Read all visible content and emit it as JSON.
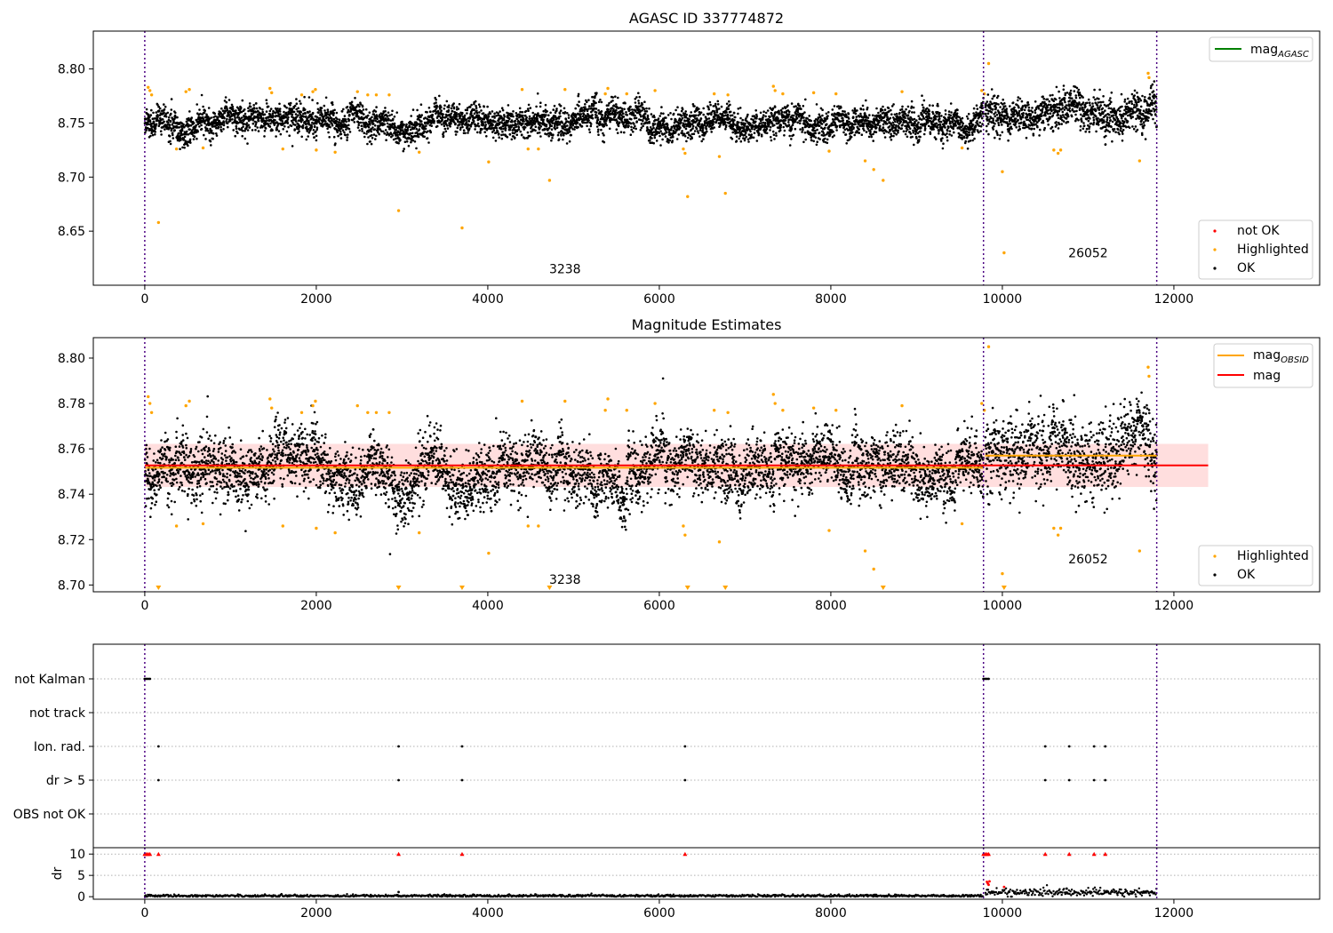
{
  "chart_data": [
    {
      "id": "agasc",
      "type": "scatter",
      "title": "AGASC ID 337774872",
      "xlim": [
        -600,
        13700
      ],
      "ylim": [
        8.6,
        8.835
      ],
      "xticks": [
        0,
        2000,
        4000,
        6000,
        8000,
        10000,
        12000
      ],
      "yticks": [
        8.65,
        8.7,
        8.75,
        8.8
      ],
      "obs_boundaries": [
        0,
        9780,
        11800
      ],
      "obs_labels": [
        {
          "text": "3238",
          "x": 4900,
          "y": 8.611
        },
        {
          "text": "26052",
          "x": 11000,
          "y": 8.626
        }
      ],
      "ok_bands": [
        {
          "x0": 0,
          "x1": 9780,
          "center": 8.751,
          "spread": 0.012
        },
        {
          "x0": 9800,
          "x1": 11800,
          "center": 8.757,
          "spread": 0.015
        }
      ],
      "highlighted": [
        [
          40,
          8.783
        ],
        [
          60,
          8.78
        ],
        [
          80,
          8.776
        ],
        [
          160,
          8.658
        ],
        [
          370,
          8.726
        ],
        [
          480,
          8.779
        ],
        [
          520,
          8.781
        ],
        [
          680,
          8.727
        ],
        [
          1460,
          8.782
        ],
        [
          1480,
          8.778
        ],
        [
          1610,
          8.726
        ],
        [
          1830,
          8.776
        ],
        [
          1960,
          8.779
        ],
        [
          1990,
          8.781
        ],
        [
          2000,
          8.725
        ],
        [
          2220,
          8.723
        ],
        [
          2480,
          8.779
        ],
        [
          2600,
          8.776
        ],
        [
          2700,
          8.776
        ],
        [
          2850,
          8.776
        ],
        [
          2960,
          8.669
        ],
        [
          3200,
          8.723
        ],
        [
          3700,
          8.653
        ],
        [
          4010,
          8.714
        ],
        [
          4400,
          8.781
        ],
        [
          4470,
          8.726
        ],
        [
          4590,
          8.726
        ],
        [
          4720,
          8.697
        ],
        [
          4900,
          8.781
        ],
        [
          5370,
          8.777
        ],
        [
          5400,
          8.782
        ],
        [
          5620,
          8.777
        ],
        [
          5950,
          8.78
        ],
        [
          6280,
          8.726
        ],
        [
          6300,
          8.722
        ],
        [
          6330,
          8.682
        ],
        [
          6640,
          8.777
        ],
        [
          6700,
          8.719
        ],
        [
          6770,
          8.685
        ],
        [
          6800,
          8.776
        ],
        [
          7330,
          8.784
        ],
        [
          7350,
          8.78
        ],
        [
          7440,
          8.777
        ],
        [
          7800,
          8.778
        ],
        [
          7980,
          8.724
        ],
        [
          8060,
          8.777
        ],
        [
          8400,
          8.715
        ],
        [
          8500,
          8.707
        ],
        [
          8610,
          8.697
        ],
        [
          8830,
          8.779
        ],
        [
          9530,
          8.727
        ],
        [
          9760,
          8.78
        ],
        [
          9790,
          8.777
        ],
        [
          9840,
          8.805
        ],
        [
          10000,
          8.705
        ],
        [
          10020,
          8.63
        ],
        [
          10600,
          8.725
        ],
        [
          10650,
          8.722
        ],
        [
          10680,
          8.725
        ],
        [
          11600,
          8.715
        ],
        [
          11700,
          8.796
        ],
        [
          11710,
          8.792
        ]
      ],
      "legend_top": [
        {
          "label": "mag",
          "sub": "AGASC",
          "color": "#008000"
        }
      ],
      "legend_bottom": [
        {
          "label": "not OK",
          "color": "#ff0000"
        },
        {
          "label": "Highlighted",
          "color": "#ffa500"
        },
        {
          "label": "OK",
          "color": "#000000"
        }
      ]
    },
    {
      "id": "estimates",
      "type": "scatter",
      "title": "Magnitude Estimates",
      "xlim": [
        -600,
        13700
      ],
      "ylim": [
        8.697,
        8.809
      ],
      "xticks": [
        0,
        2000,
        4000,
        6000,
        8000,
        10000,
        12000
      ],
      "yticks": [
        8.7,
        8.72,
        8.74,
        8.76,
        8.78,
        8.8
      ],
      "obs_boundaries": [
        0,
        9780,
        11800
      ],
      "obs_labels": [
        {
          "text": "3238",
          "x": 4900,
          "y": 8.7005
        },
        {
          "text": "26052",
          "x": 11000,
          "y": 8.7095
        }
      ],
      "mag_line": {
        "y": 8.7527,
        "x0": 0,
        "x1": 12400,
        "band": [
          8.7432,
          8.7622
        ]
      },
      "obsid_mag": [
        {
          "x0": 0,
          "x1": 9780,
          "y": 8.7517
        },
        {
          "x0": 9800,
          "x1": 11800,
          "y": 8.757
        }
      ],
      "ok_bands": [
        {
          "x0": 0,
          "x1": 9780,
          "center": 8.751,
          "spread": 0.012
        },
        {
          "x0": 9800,
          "x1": 11800,
          "center": 8.757,
          "spread": 0.015
        }
      ],
      "highlighted": [
        [
          40,
          8.783
        ],
        [
          60,
          8.78
        ],
        [
          80,
          8.776
        ],
        [
          370,
          8.726
        ],
        [
          480,
          8.779
        ],
        [
          520,
          8.781
        ],
        [
          680,
          8.727
        ],
        [
          1460,
          8.782
        ],
        [
          1480,
          8.778
        ],
        [
          1610,
          8.726
        ],
        [
          1830,
          8.776
        ],
        [
          1960,
          8.779
        ],
        [
          1990,
          8.781
        ],
        [
          2000,
          8.725
        ],
        [
          2220,
          8.723
        ],
        [
          2480,
          8.779
        ],
        [
          2600,
          8.776
        ],
        [
          2700,
          8.776
        ],
        [
          2850,
          8.776
        ],
        [
          3200,
          8.723
        ],
        [
          4010,
          8.714
        ],
        [
          4400,
          8.781
        ],
        [
          4470,
          8.726
        ],
        [
          4590,
          8.726
        ],
        [
          4900,
          8.781
        ],
        [
          5370,
          8.777
        ],
        [
          5400,
          8.782
        ],
        [
          5620,
          8.777
        ],
        [
          5950,
          8.78
        ],
        [
          6280,
          8.726
        ],
        [
          6300,
          8.722
        ],
        [
          6640,
          8.777
        ],
        [
          6700,
          8.719
        ],
        [
          6800,
          8.776
        ],
        [
          7330,
          8.784
        ],
        [
          7350,
          8.78
        ],
        [
          7440,
          8.777
        ],
        [
          7800,
          8.778
        ],
        [
          7980,
          8.724
        ],
        [
          8060,
          8.777
        ],
        [
          8400,
          8.715
        ],
        [
          8500,
          8.707
        ],
        [
          8830,
          8.779
        ],
        [
          9530,
          8.727
        ],
        [
          9760,
          8.78
        ],
        [
          9790,
          8.777
        ],
        [
          9840,
          8.805
        ],
        [
          10000,
          8.705
        ],
        [
          10600,
          8.725
        ],
        [
          10650,
          8.722
        ],
        [
          10680,
          8.725
        ],
        [
          11600,
          8.715
        ],
        [
          11700,
          8.796
        ],
        [
          11710,
          8.792
        ]
      ],
      "off_scale": [
        160,
        2960,
        3700,
        4720,
        6330,
        6770,
        8610,
        10020
      ],
      "legend_top": [
        {
          "label": "mag",
          "sub": "OBSID",
          "color": "#ffa500"
        },
        {
          "label": "mag",
          "sub": "",
          "color": "#ff0000"
        }
      ],
      "legend_bottom": [
        {
          "label": "Highlighted",
          "color": "#ffa500"
        },
        {
          "label": "OK",
          "color": "#000000"
        }
      ]
    },
    {
      "id": "flags",
      "type": "scatter",
      "xlim": [
        -600,
        13700
      ],
      "categories": [
        "not Kalman",
        "not track",
        "Ion. rad.",
        "dr > 5",
        "OBS not OK"
      ],
      "obs_boundaries": [
        0,
        9780,
        11800
      ],
      "flags": {
        "not Kalman": [
          0,
          20,
          40,
          60,
          9780,
          9800,
          9820,
          9840
        ],
        "not track": [],
        "Ion. rad.": [
          160,
          2960,
          3700,
          6300,
          10500,
          10780,
          11070,
          11200
        ],
        "dr > 5": [
          160,
          2960,
          3700,
          6300,
          10500,
          10780,
          11070,
          11200
        ],
        "OBS not OK": []
      }
    },
    {
      "id": "dr",
      "type": "scatter",
      "xlim": [
        -600,
        13700
      ],
      "ylim": [
        -0.6,
        11.5
      ],
      "yticks": [
        0,
        5,
        10
      ],
      "ylabel": "dr",
      "xticks": [
        0,
        2000,
        4000,
        6000,
        8000,
        10000,
        12000
      ],
      "obs_boundaries": [
        0,
        9780,
        11800
      ],
      "clipped": [
        0,
        20,
        40,
        60,
        160,
        2960,
        3700,
        6300,
        9780,
        9800,
        9820,
        9840,
        10500,
        10780,
        11070,
        11200
      ],
      "bands": [
        {
          "x0": 0,
          "x1": 9780,
          "center": 0.2,
          "spread": 0.15
        },
        {
          "x0": 9800,
          "x1": 11800,
          "center": 1.0,
          "spread": 0.45
        }
      ],
      "outliers": [
        [
          2960,
          1.1
        ],
        [
          9820,
          3.5
        ],
        [
          9830,
          3.1
        ],
        [
          9840,
          2.8
        ],
        [
          9850,
          3.6
        ],
        [
          10020,
          2.3
        ],
        [
          10750,
          1.9
        ]
      ]
    }
  ],
  "colors": {
    "ok": "#000000",
    "highlighted": "#ffa500",
    "not_ok": "#ff0000",
    "agasc": "#008000",
    "boundary": "#4b0082",
    "grid": "#b0b0b0"
  }
}
